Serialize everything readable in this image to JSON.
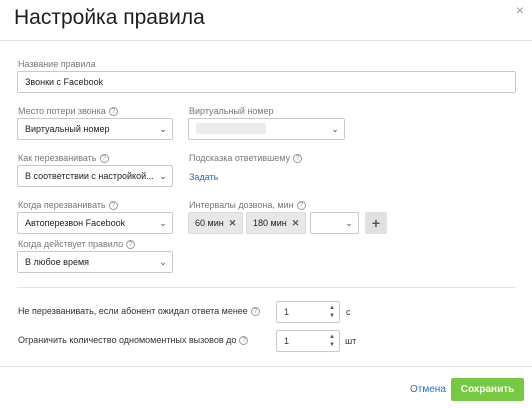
{
  "dialog": {
    "title": "Настройка правила",
    "close_symbol": "×"
  },
  "rule_name": {
    "label": "Название правила",
    "value": "Звонки с Facebook"
  },
  "loss_place": {
    "label": "Место потери звонка",
    "value": "Виртуальный номер"
  },
  "virtual_number": {
    "label": "Виртуальный номер",
    "value_hidden": true
  },
  "how_callback": {
    "label": "Как перезванивать",
    "value": "В соответствии с настройкой..."
  },
  "hint": {
    "label": "Подсказка ответившему",
    "link": "Задать"
  },
  "when_callback": {
    "label": "Когда перезванивать",
    "value": "Автоперезвон Facebook"
  },
  "intervals": {
    "label": "Интервалы дозвона, мин",
    "chips": [
      "60 мин",
      "180 мин"
    ],
    "remove_symbol": "✕",
    "add_symbol": "+"
  },
  "rule_active": {
    "label": "Когда действует правило",
    "value": "В любое время"
  },
  "no_callback": {
    "label": "Не перезванивать, если абонент ожидал ответа менее",
    "value": "1",
    "unit": "с"
  },
  "limit_calls": {
    "label": "Ограничить количество одномоментных вызовов до",
    "value": "1",
    "unit": "шт"
  },
  "footer": {
    "cancel_label": "Отмена",
    "save_label": "Сохранить"
  },
  "help_symbol": "?",
  "chevron_symbol": "⌄",
  "colors": {
    "accent_green": "#77c843",
    "link_blue": "#2a6ebb"
  }
}
